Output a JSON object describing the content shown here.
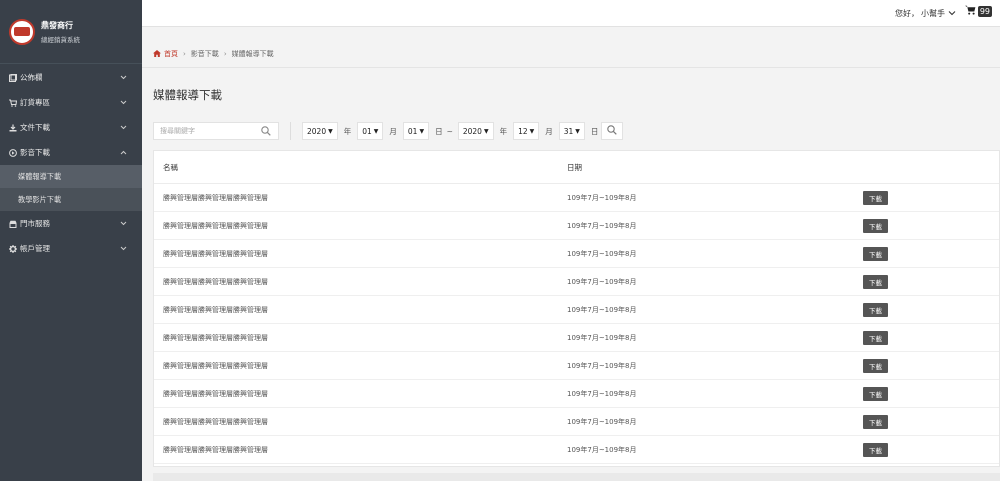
{
  "brand": {
    "name": "鼎發商行",
    "subtitle": "總經銷貨系統"
  },
  "sidebar": {
    "items": [
      {
        "label": "公佈欄",
        "icon": "bulletin-icon",
        "expanded": false
      },
      {
        "label": "訂貨專區",
        "icon": "cart-icon",
        "expanded": false
      },
      {
        "label": "文件下載",
        "icon": "download-icon",
        "expanded": false
      },
      {
        "label": "影音下載",
        "icon": "play-icon",
        "expanded": true
      },
      {
        "label": "門市服務",
        "icon": "store-icon",
        "expanded": false
      },
      {
        "label": "帳戶管理",
        "icon": "gear-icon",
        "expanded": false
      }
    ],
    "submenu": [
      {
        "label": "媒體報導下載",
        "active": true
      },
      {
        "label": "教學影片下載",
        "active": false
      }
    ]
  },
  "header": {
    "greeting": "您好，",
    "username": "小幫手",
    "cart_count": "99"
  },
  "breadcrumb": {
    "home": "首頁",
    "level1": "影音下載",
    "level2": "媒體報導下載"
  },
  "page": {
    "title": "媒體報導下載"
  },
  "filters": {
    "search_placeholder": "搜尋關鍵字",
    "start_year": "2020",
    "start_month": "01",
    "start_day": "01",
    "end_year": "2020",
    "end_month": "12",
    "end_day": "31",
    "unit_year": "年",
    "unit_month": "月",
    "unit_day": "日",
    "range_sep": "~"
  },
  "table": {
    "headers": {
      "name": "名稱",
      "date": "日期"
    },
    "download_label": "下載",
    "rows": [
      {
        "name": "勝興管理層勝興管理層勝興管理層",
        "date": "109年7月~109年8月"
      },
      {
        "name": "勝興管理層勝興管理層勝興管理層",
        "date": "109年7月~109年8月"
      },
      {
        "name": "勝興管理層勝興管理層勝興管理層",
        "date": "109年7月~109年8月"
      },
      {
        "name": "勝興管理層勝興管理層勝興管理層",
        "date": "109年7月~109年8月"
      },
      {
        "name": "勝興管理層勝興管理層勝興管理層",
        "date": "109年7月~109年8月"
      },
      {
        "name": "勝興管理層勝興管理層勝興管理層",
        "date": "109年7月~109年8月"
      },
      {
        "name": "勝興管理層勝興管理層勝興管理層",
        "date": "109年7月~109年8月"
      },
      {
        "name": "勝興管理層勝興管理層勝興管理層",
        "date": "109年7月~109年8月"
      },
      {
        "name": "勝興管理層勝興管理層勝興管理層",
        "date": "109年7月~109年8月"
      },
      {
        "name": "勝興管理層勝興管理層勝興管理層",
        "date": "109年7月~109年8月"
      }
    ]
  },
  "colors": {
    "sidebar_bg": "#394049",
    "active_item_bg": "#575e67",
    "accent_red": "#c0392b",
    "button_bg": "#555555"
  }
}
